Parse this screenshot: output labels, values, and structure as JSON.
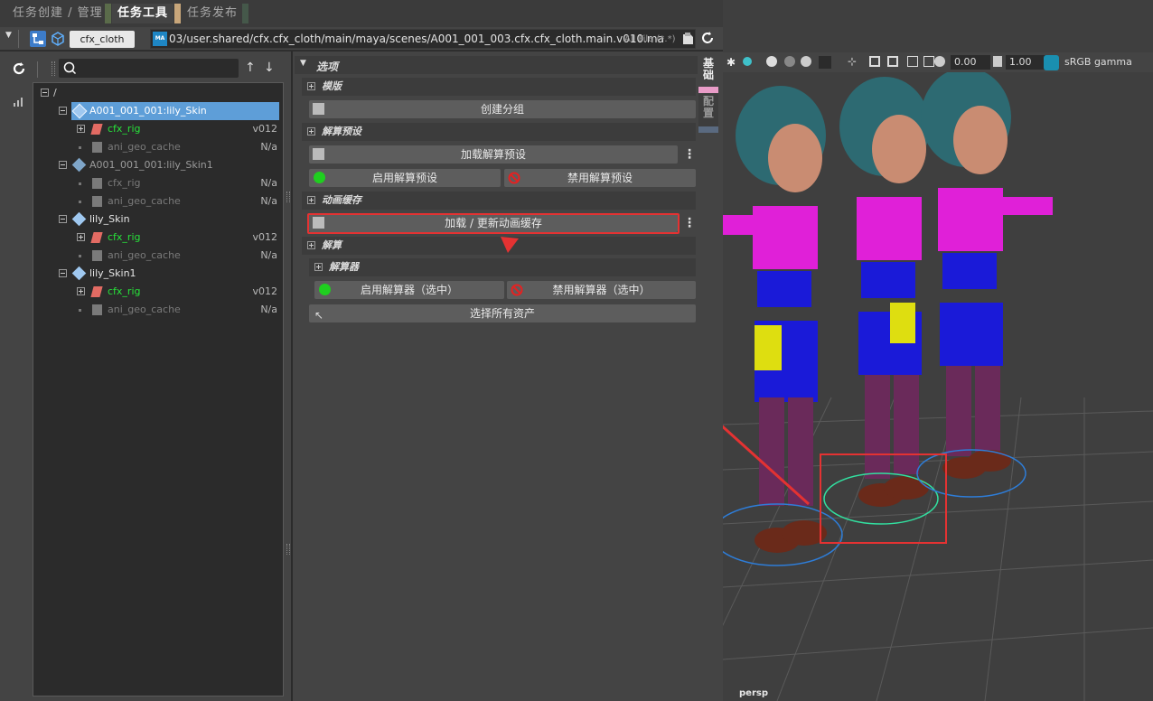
{
  "tabs": [
    {
      "label": "任务创建 / 管理",
      "active": false
    },
    {
      "label": "任务工具",
      "active": true
    },
    {
      "label": "任务发布",
      "active": false
    }
  ],
  "toolbar": {
    "project_combo": "cfx_cloth",
    "file_path": "03/user.shared/cfx.cfx_cloth/main/maya/scenes/A001_001_003.cfx.cfx_cloth.main.v010.ma",
    "file_filter": "All File (*.*)"
  },
  "search": {
    "value": ""
  },
  "tree": [
    {
      "label": "/",
      "kind": "root",
      "version": ""
    },
    {
      "label": "A001_001_001:lily_Skin",
      "kind": "asset",
      "version": "",
      "selected": true
    },
    {
      "label": "cfx_rig",
      "kind": "rig",
      "version": "v012"
    },
    {
      "label": "ani_geo_cache",
      "kind": "cache",
      "version": "N/a"
    },
    {
      "label": "A001_001_001:lily_Skin1",
      "kind": "asset-dim",
      "version": ""
    },
    {
      "label": "cfx_rig",
      "kind": "rig-dim",
      "version": "N/a"
    },
    {
      "label": "ani_geo_cache",
      "kind": "cache",
      "version": "N/a"
    },
    {
      "label": "lily_Skin",
      "kind": "asset",
      "version": ""
    },
    {
      "label": "cfx_rig",
      "kind": "rig",
      "version": "v012"
    },
    {
      "label": "ani_geo_cache",
      "kind": "cache",
      "version": "N/a"
    },
    {
      "label": "lily_Skin1",
      "kind": "asset",
      "version": ""
    },
    {
      "label": "cfx_rig",
      "kind": "rig",
      "version": "v012"
    },
    {
      "label": "ani_geo_cache",
      "kind": "cache",
      "version": "N/a"
    }
  ],
  "options": {
    "title": "选项",
    "template": {
      "title": "模版",
      "create_group": "创建分组"
    },
    "solver_preset": {
      "title": "解算预设",
      "load": "加载解算预设",
      "enable": "启用解算预设",
      "disable": "禁用解算预设"
    },
    "anim_cache": {
      "title": "动画缓存",
      "load_update": "加载 / 更新动画缓存"
    },
    "solve": {
      "title": "解算",
      "solver_title": "解算器",
      "enable_solver": "启用解算器（选中）",
      "disable_solver": "禁用解算器（选中）",
      "select_all": "选择所有资产"
    }
  },
  "side_tabs": [
    "基础",
    "配置"
  ],
  "viewport": {
    "camera": "persp",
    "exposure": "0.00",
    "gamma": "1.00",
    "color_space": "sRGB gamma"
  },
  "colors": {
    "selection": "#5e9ed8",
    "rig_green": "#27e23a",
    "annotation_red": "#e43232",
    "accent_pink": "#e99cc8"
  }
}
